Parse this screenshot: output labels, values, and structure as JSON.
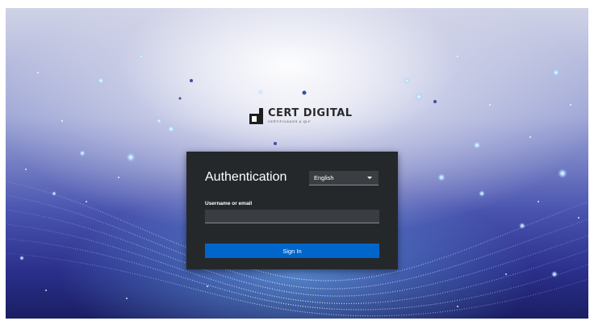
{
  "brand": {
    "name": "CERT DIGITAL",
    "tagline": "CERTIFICADOS & QLF"
  },
  "login": {
    "title": "Authentication",
    "language": {
      "selected": "English"
    },
    "username": {
      "label": "Username or email",
      "value": "",
      "placeholder": ""
    },
    "submit_label": "Sign In"
  },
  "colors": {
    "card_background": "#25282b",
    "input_background": "#3a3d41",
    "primary_button": "#0066cc"
  }
}
